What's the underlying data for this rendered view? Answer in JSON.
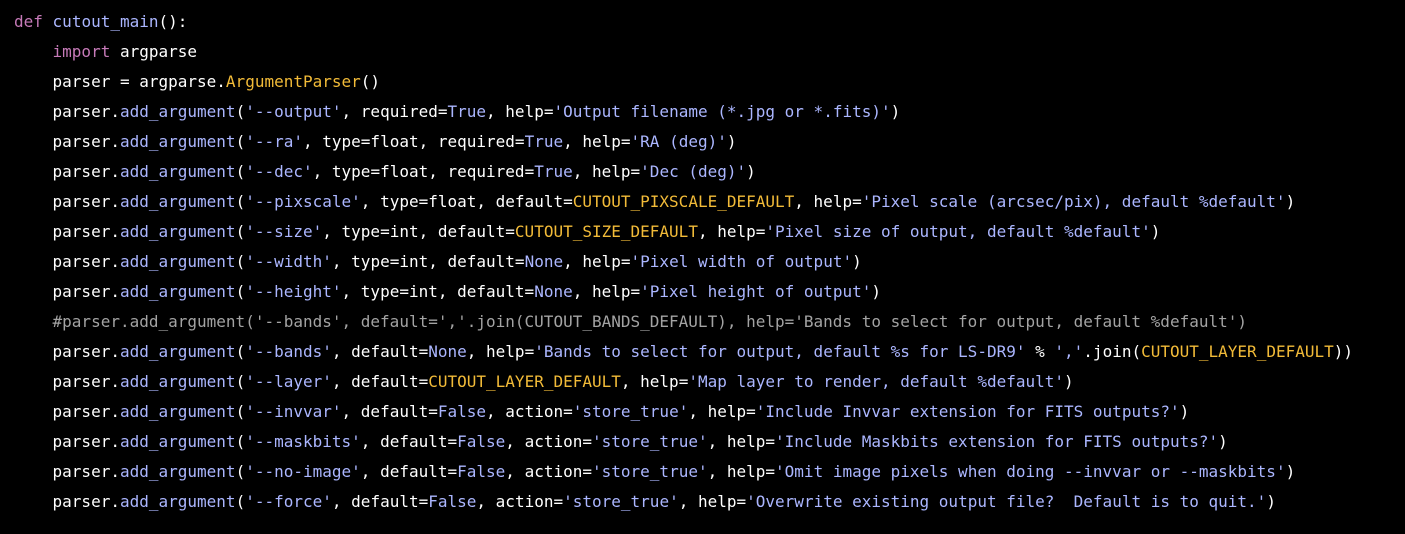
{
  "colors": {
    "background": "#000000",
    "plain": "#ffffff",
    "keyword": "#c67ab8",
    "blue": "#abb6ff",
    "constant": "#f2bb38",
    "comment": "#a3a3a3"
  },
  "code": {
    "lines": [
      {
        "indent": "",
        "tokens": [
          {
            "t": "def",
            "k": "keyword"
          },
          {
            "t": " ",
            "k": "plain"
          },
          {
            "t": "cutout_main",
            "k": "func"
          },
          {
            "t": "():",
            "k": "plain"
          }
        ]
      },
      {
        "indent": "    ",
        "tokens": [
          {
            "t": "import",
            "k": "keyword"
          },
          {
            "t": " argparse",
            "k": "plain"
          }
        ]
      },
      {
        "indent": "    ",
        "tokens": [
          {
            "t": "parser = argparse.",
            "k": "plain"
          },
          {
            "t": "ArgumentParser",
            "k": "class"
          },
          {
            "t": "()",
            "k": "plain"
          }
        ]
      },
      {
        "indent": "    ",
        "tokens": [
          {
            "t": "parser.",
            "k": "plain"
          },
          {
            "t": "add_argument",
            "k": "attr"
          },
          {
            "t": "(",
            "k": "plain"
          },
          {
            "t": "'--output'",
            "k": "string"
          },
          {
            "t": ", required=",
            "k": "plain"
          },
          {
            "t": "True",
            "k": "builtin"
          },
          {
            "t": ", help=",
            "k": "plain"
          },
          {
            "t": "'Output filename (*.jpg or *.fits)'",
            "k": "string"
          },
          {
            "t": ")",
            "k": "plain"
          }
        ]
      },
      {
        "indent": "    ",
        "tokens": [
          {
            "t": "parser.",
            "k": "plain"
          },
          {
            "t": "add_argument",
            "k": "attr"
          },
          {
            "t": "(",
            "k": "plain"
          },
          {
            "t": "'--ra'",
            "k": "string"
          },
          {
            "t": ", type=float, required=",
            "k": "plain"
          },
          {
            "t": "True",
            "k": "builtin"
          },
          {
            "t": ", help=",
            "k": "plain"
          },
          {
            "t": "'RA (deg)'",
            "k": "string"
          },
          {
            "t": ")",
            "k": "plain"
          }
        ]
      },
      {
        "indent": "    ",
        "tokens": [
          {
            "t": "parser.",
            "k": "plain"
          },
          {
            "t": "add_argument",
            "k": "attr"
          },
          {
            "t": "(",
            "k": "plain"
          },
          {
            "t": "'--dec'",
            "k": "string"
          },
          {
            "t": ", type=float, required=",
            "k": "plain"
          },
          {
            "t": "True",
            "k": "builtin"
          },
          {
            "t": ", help=",
            "k": "plain"
          },
          {
            "t": "'Dec (deg)'",
            "k": "string"
          },
          {
            "t": ")",
            "k": "plain"
          }
        ]
      },
      {
        "indent": "    ",
        "tokens": [
          {
            "t": "parser.",
            "k": "plain"
          },
          {
            "t": "add_argument",
            "k": "attr"
          },
          {
            "t": "(",
            "k": "plain"
          },
          {
            "t": "'--pixscale'",
            "k": "string"
          },
          {
            "t": ", type=float, default=",
            "k": "plain"
          },
          {
            "t": "CUTOUT_PIXSCALE_DEFAULT",
            "k": "constant"
          },
          {
            "t": ", help=",
            "k": "plain"
          },
          {
            "t": "'Pixel scale (arcsec/pix), default %default'",
            "k": "string"
          },
          {
            "t": ")",
            "k": "plain"
          }
        ]
      },
      {
        "indent": "    ",
        "tokens": [
          {
            "t": "parser.",
            "k": "plain"
          },
          {
            "t": "add_argument",
            "k": "attr"
          },
          {
            "t": "(",
            "k": "plain"
          },
          {
            "t": "'--size'",
            "k": "string"
          },
          {
            "t": ", type=int, default=",
            "k": "plain"
          },
          {
            "t": "CUTOUT_SIZE_DEFAULT",
            "k": "constant"
          },
          {
            "t": ", help=",
            "k": "plain"
          },
          {
            "t": "'Pixel size of output, default %default'",
            "k": "string"
          },
          {
            "t": ")",
            "k": "plain"
          }
        ]
      },
      {
        "indent": "    ",
        "tokens": [
          {
            "t": "parser.",
            "k": "plain"
          },
          {
            "t": "add_argument",
            "k": "attr"
          },
          {
            "t": "(",
            "k": "plain"
          },
          {
            "t": "'--width'",
            "k": "string"
          },
          {
            "t": ", type=int, default=",
            "k": "plain"
          },
          {
            "t": "None",
            "k": "builtin"
          },
          {
            "t": ", help=",
            "k": "plain"
          },
          {
            "t": "'Pixel width of output'",
            "k": "string"
          },
          {
            "t": ")",
            "k": "plain"
          }
        ]
      },
      {
        "indent": "    ",
        "tokens": [
          {
            "t": "parser.",
            "k": "plain"
          },
          {
            "t": "add_argument",
            "k": "attr"
          },
          {
            "t": "(",
            "k": "plain"
          },
          {
            "t": "'--height'",
            "k": "string"
          },
          {
            "t": ", type=int, default=",
            "k": "plain"
          },
          {
            "t": "None",
            "k": "builtin"
          },
          {
            "t": ", help=",
            "k": "plain"
          },
          {
            "t": "'Pixel height of output'",
            "k": "string"
          },
          {
            "t": ")",
            "k": "plain"
          }
        ]
      },
      {
        "indent": "    ",
        "tokens": [
          {
            "t": "#parser.add_argument('--bands', default=','.join(CUTOUT_BANDS_DEFAULT), help='Bands to select for output, default %default')",
            "k": "comment"
          }
        ]
      },
      {
        "indent": "    ",
        "tokens": [
          {
            "t": "parser.",
            "k": "plain"
          },
          {
            "t": "add_argument",
            "k": "attr"
          },
          {
            "t": "(",
            "k": "plain"
          },
          {
            "t": "'--bands'",
            "k": "string"
          },
          {
            "t": ", default=",
            "k": "plain"
          },
          {
            "t": "None",
            "k": "builtin"
          },
          {
            "t": ", help=",
            "k": "plain"
          },
          {
            "t": "'Bands to select for output, default %s for LS-DR9'",
            "k": "string"
          },
          {
            "t": " % ",
            "k": "plain"
          },
          {
            "t": "','",
            "k": "string"
          },
          {
            "t": ".join(",
            "k": "plain"
          },
          {
            "t": "CUTOUT_LAYER_DEFAULT",
            "k": "constant"
          },
          {
            "t": "))",
            "k": "plain"
          }
        ]
      },
      {
        "indent": "    ",
        "tokens": [
          {
            "t": "parser.",
            "k": "plain"
          },
          {
            "t": "add_argument",
            "k": "attr"
          },
          {
            "t": "(",
            "k": "plain"
          },
          {
            "t": "'--layer'",
            "k": "string"
          },
          {
            "t": ", default=",
            "k": "plain"
          },
          {
            "t": "CUTOUT_LAYER_DEFAULT",
            "k": "constant"
          },
          {
            "t": ", help=",
            "k": "plain"
          },
          {
            "t": "'Map layer to render, default %default'",
            "k": "string"
          },
          {
            "t": ")",
            "k": "plain"
          }
        ]
      },
      {
        "indent": "    ",
        "tokens": [
          {
            "t": "parser.",
            "k": "plain"
          },
          {
            "t": "add_argument",
            "k": "attr"
          },
          {
            "t": "(",
            "k": "plain"
          },
          {
            "t": "'--invvar'",
            "k": "string"
          },
          {
            "t": ", default=",
            "k": "plain"
          },
          {
            "t": "False",
            "k": "builtin"
          },
          {
            "t": ", action=",
            "k": "plain"
          },
          {
            "t": "'store_true'",
            "k": "string"
          },
          {
            "t": ", help=",
            "k": "plain"
          },
          {
            "t": "'Include Invvar extension for FITS outputs?'",
            "k": "string"
          },
          {
            "t": ")",
            "k": "plain"
          }
        ]
      },
      {
        "indent": "    ",
        "tokens": [
          {
            "t": "parser.",
            "k": "plain"
          },
          {
            "t": "add_argument",
            "k": "attr"
          },
          {
            "t": "(",
            "k": "plain"
          },
          {
            "t": "'--maskbits'",
            "k": "string"
          },
          {
            "t": ", default=",
            "k": "plain"
          },
          {
            "t": "False",
            "k": "builtin"
          },
          {
            "t": ", action=",
            "k": "plain"
          },
          {
            "t": "'store_true'",
            "k": "string"
          },
          {
            "t": ", help=",
            "k": "plain"
          },
          {
            "t": "'Include Maskbits extension for FITS outputs?'",
            "k": "string"
          },
          {
            "t": ")",
            "k": "plain"
          }
        ]
      },
      {
        "indent": "    ",
        "tokens": [
          {
            "t": "parser.",
            "k": "plain"
          },
          {
            "t": "add_argument",
            "k": "attr"
          },
          {
            "t": "(",
            "k": "plain"
          },
          {
            "t": "'--no-image'",
            "k": "string"
          },
          {
            "t": ", default=",
            "k": "plain"
          },
          {
            "t": "False",
            "k": "builtin"
          },
          {
            "t": ", action=",
            "k": "plain"
          },
          {
            "t": "'store_true'",
            "k": "string"
          },
          {
            "t": ", help=",
            "k": "plain"
          },
          {
            "t": "'Omit image pixels when doing --invvar or --maskbits'",
            "k": "string"
          },
          {
            "t": ")",
            "k": "plain"
          }
        ]
      },
      {
        "indent": "    ",
        "tokens": [
          {
            "t": "parser.",
            "k": "plain"
          },
          {
            "t": "add_argument",
            "k": "attr"
          },
          {
            "t": "(",
            "k": "plain"
          },
          {
            "t": "'--force'",
            "k": "string"
          },
          {
            "t": ", default=",
            "k": "plain"
          },
          {
            "t": "False",
            "k": "builtin"
          },
          {
            "t": ", action=",
            "k": "plain"
          },
          {
            "t": "'store_true'",
            "k": "string"
          },
          {
            "t": ", help=",
            "k": "plain"
          },
          {
            "t": "'Overwrite existing output file?  Default is to quit.'",
            "k": "string"
          },
          {
            "t": ")",
            "k": "plain"
          }
        ]
      }
    ]
  }
}
